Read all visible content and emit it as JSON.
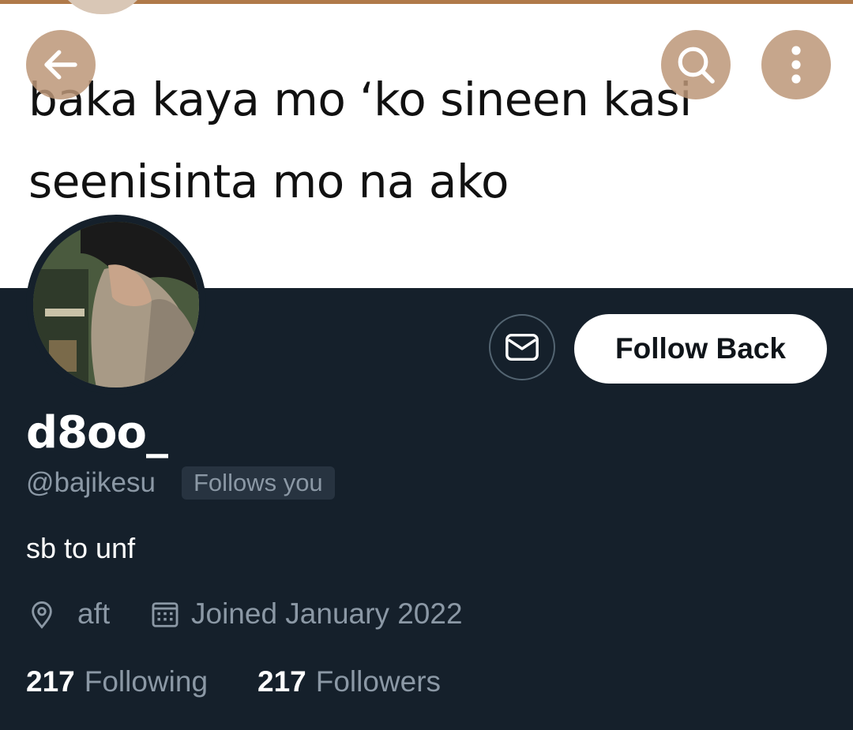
{
  "banner": {
    "line1": "baka kaya mo ‘ko sineen kasi",
    "line2": "seenisinta mo na ako"
  },
  "toolbar": {
    "back_icon": "arrow-left-icon",
    "search_icon": "search-icon",
    "more_icon": "more-vertical-icon"
  },
  "profile": {
    "display_name": "d8oo_",
    "handle": "@bajikesu",
    "follows_you": "Follows you",
    "bio": "sb to unf",
    "location": "aft",
    "joined": "Joined January 2022",
    "following_count": "217",
    "following_label": "Following",
    "followers_count": "217",
    "followers_label": "Followers"
  },
  "actions": {
    "follow_back_label": "Follow Back",
    "message_icon": "mail-icon"
  },
  "colors": {
    "background": "#15202b",
    "secondary_text": "#8b98a5",
    "primary_text": "#ffffff",
    "overlay_button": "#bc9678"
  }
}
